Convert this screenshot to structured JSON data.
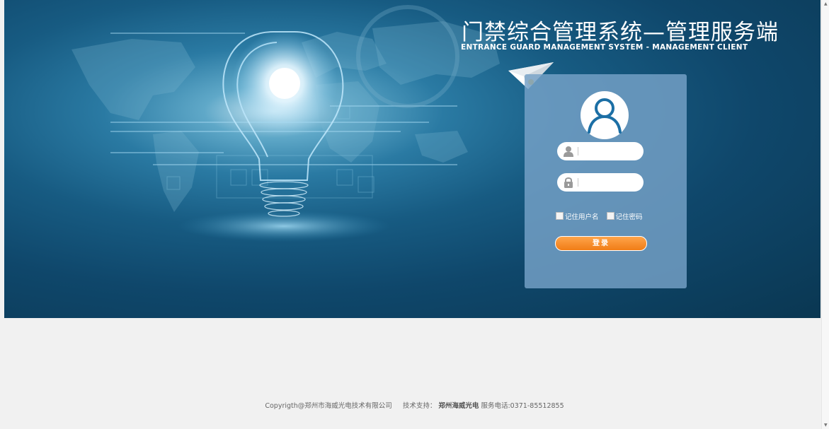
{
  "header": {
    "title_zh": "门禁综合管理系统—管理服务端",
    "title_en": "ENTRANCE GUARD MANAGEMENT SYSTEM - MANAGEMENT CLIENT"
  },
  "login": {
    "username": {
      "value": "",
      "placeholder": "",
      "icon": "user-icon"
    },
    "password": {
      "value": "",
      "placeholder": "",
      "icon": "lock-icon"
    },
    "remember_username_label": "记住用户名",
    "remember_password_label": "记住密码",
    "login_button_label": "登录"
  },
  "footer": {
    "copyright": "Copyrigth@郑州市海威光电技术有限公司",
    "support_label": "技术支持：",
    "support_company": "郑州海威光电",
    "phone": "服务电话:0371-85512855"
  },
  "colors": {
    "banner_dark": "#0a3752",
    "banner_light": "#2a7aa3",
    "panel": "#76a2c8",
    "login_button": "#f7881c",
    "page_background": "#f1f1f1"
  }
}
